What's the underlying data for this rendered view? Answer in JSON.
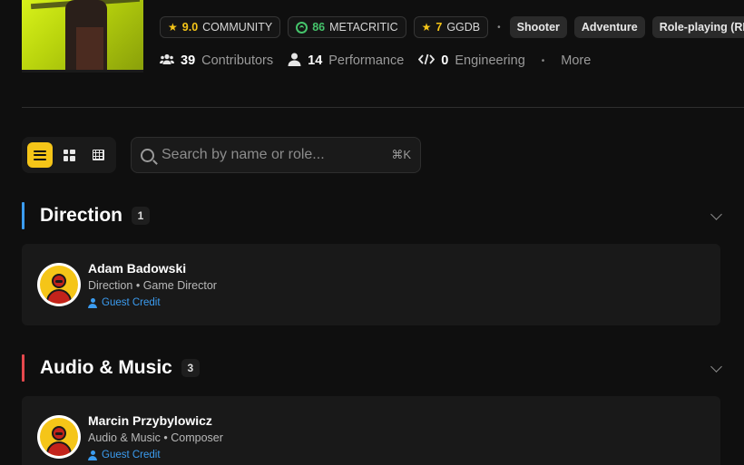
{
  "game": {
    "cover_alt": "Cyberpunk 2077 cover art"
  },
  "ratings": [
    {
      "icon": "star-icon",
      "value": "9.0",
      "label": "COMMUNITY",
      "color": "#f5c518"
    },
    {
      "icon": "metacritic-icon",
      "value": "86",
      "label": "METACRITIC",
      "color": "#45c46b"
    },
    {
      "icon": "star-icon",
      "value": "7",
      "label": "GGDB",
      "color": "#f5c518"
    }
  ],
  "genres": [
    "Shooter",
    "Adventure",
    "Role-playing (RPG)"
  ],
  "stats": [
    {
      "icon": "users-icon",
      "value": "39",
      "label": "Contributors"
    },
    {
      "icon": "user-icon",
      "value": "14",
      "label": "Performance"
    },
    {
      "icon": "code-icon",
      "value": "0",
      "label": "Engineering"
    }
  ],
  "more_label": "More",
  "views": {
    "active": "list",
    "options": [
      "list",
      "grid",
      "table"
    ]
  },
  "search": {
    "placeholder": "Search by name or role...",
    "value": "",
    "shortcut": "⌘K"
  },
  "sections": [
    {
      "title": "Direction",
      "count": "1",
      "accent": "#3b9cf0",
      "people": [
        {
          "name": "Adam Badowski",
          "department": "Direction",
          "role": "Game Director",
          "credit": "Guest Credit"
        }
      ]
    },
    {
      "title": "Audio & Music",
      "count": "3",
      "accent": "#e5484d",
      "people": [
        {
          "name": "Marcin Przybylowicz",
          "department": "Audio & Music",
          "role": "Composer",
          "credit": "Guest Credit"
        }
      ]
    }
  ],
  "separator": "•"
}
